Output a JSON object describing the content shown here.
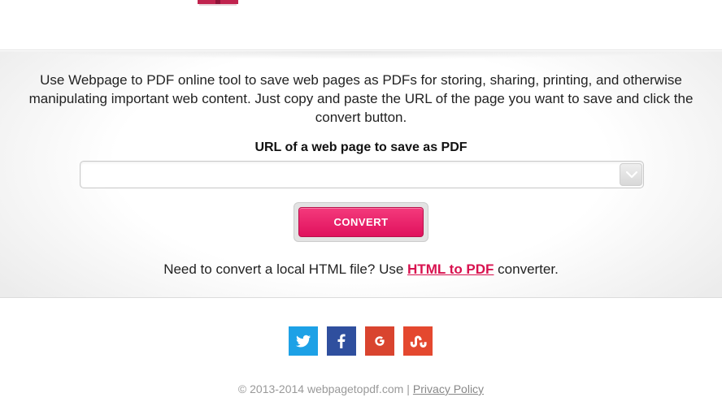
{
  "brand": {
    "logo_colors": [
      "#c0234e",
      "#8f1237"
    ]
  },
  "intro": {
    "text": "Use Webpage to PDF online tool to save web pages as PDFs for storing, sharing, printing, and otherwise manipulating important web content. Just copy and paste the URL of the page you want to save and click the convert button."
  },
  "form": {
    "url_label": "URL of a web page to save as PDF",
    "url_value": "",
    "url_placeholder": "",
    "dropdown_icon": "chevron-down-icon",
    "convert_label": "CONVERT",
    "accent_color": "#e8175f"
  },
  "local": {
    "prefix": "Need to convert a local HTML file? Use ",
    "link_text": "HTML to PDF",
    "suffix": " converter."
  },
  "social": [
    {
      "name": "twitter",
      "icon": "twitter-icon",
      "color": "#1da1e6"
    },
    {
      "name": "facebook",
      "icon": "facebook-icon",
      "color": "#2f4f9e"
    },
    {
      "name": "google",
      "icon": "google-icon",
      "color": "#d9442f"
    },
    {
      "name": "stumbleupon",
      "icon": "stumbleupon-icon",
      "color": "#e4482f"
    }
  ],
  "footer": {
    "copyright": "© 2013-2014 webpagetopdf.com",
    "separator": "|",
    "privacy_label": "Privacy Policy"
  }
}
